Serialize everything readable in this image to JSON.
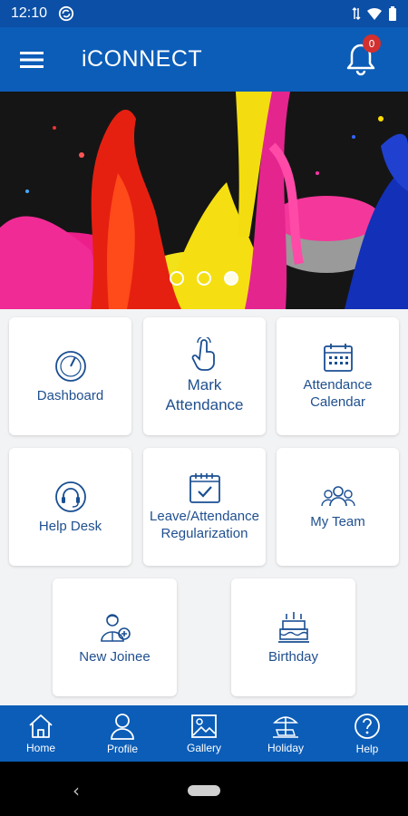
{
  "status": {
    "time": "12:10"
  },
  "app": {
    "title": "iCONNECT",
    "notification_count": "0"
  },
  "tiles": {
    "dashboard": "Dashboard",
    "mark_attendance": "Mark\nAttendance",
    "attendance_calendar": "Attendance\nCalendar",
    "help_desk": "Help Desk",
    "leave_regularization": "Leave/Attendance\nRegularization",
    "my_team": "My Team",
    "new_joinee": "New Joinee",
    "birthday": "Birthday"
  },
  "nav": {
    "home": "Home",
    "profile": "Profile",
    "gallery": "Gallery",
    "holiday": "Holiday",
    "help": "Help"
  },
  "banner": {
    "slide_count": 3,
    "active_slide": 3
  },
  "colors": {
    "primary": "#0b5db8",
    "icon": "#1a4f93",
    "badge": "#d32f2f"
  }
}
